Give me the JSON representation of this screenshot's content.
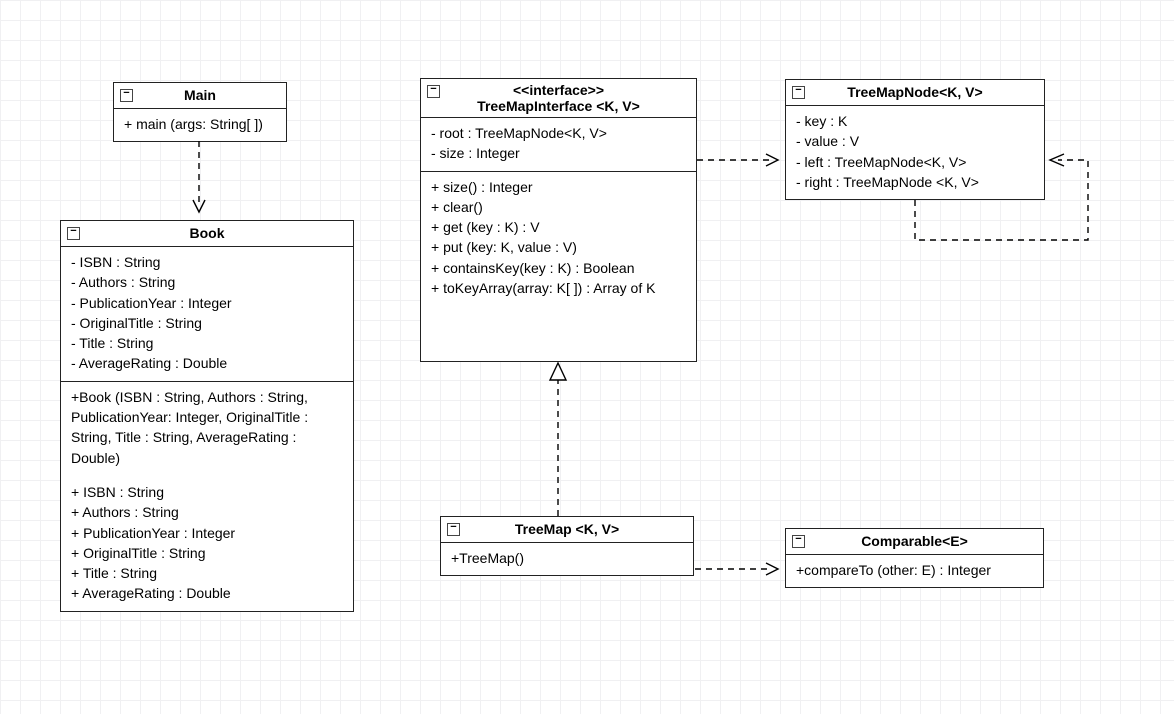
{
  "chart_data": {
    "type": "diagram",
    "title": "UML Class Diagram",
    "classes": [
      {
        "id": "Main",
        "name": "Main",
        "methods": [
          "+ main (args: String[ ])"
        ]
      },
      {
        "id": "Book",
        "name": "Book",
        "attrs": [
          "- ISBN : String",
          "- Authors : String",
          "- PublicationYear : Integer",
          "- OriginalTitle : String",
          "- Title : String",
          "- AverageRating : Double"
        ],
        "methods": [
          "+Book (ISBN : String, Authors : String, PublicationYear: Integer, OriginalTitle : String, Title : String, AverageRating : Double)",
          "",
          "+ ISBN : String",
          "+ Authors : String",
          "+ PublicationYear : Integer",
          "+ OriginalTitle : String",
          "+ Title : String",
          "+ AverageRating : Double"
        ]
      },
      {
        "id": "TreeMapInterface",
        "stereotype": "<<interface>>",
        "name": "TreeMapInterface <K, V>",
        "attrs": [
          "- root : TreeMapNode<K, V>",
          "- size : Integer"
        ],
        "methods": [
          "+ size() : Integer",
          "+ clear()",
          "+ get (key : K) : V",
          "+ put (key: K, value : V)",
          "+ containsKey(key : K) : Boolean",
          "+ toKeyArray(array: K[ ]) : Array of K"
        ]
      },
      {
        "id": "TreeMapNode",
        "name": "TreeMapNode<K, V>",
        "attrs": [
          "- key : K",
          "- value : V",
          "- left : TreeMapNode<K, V>",
          "- right : TreeMapNode <K, V>"
        ]
      },
      {
        "id": "TreeMap",
        "name": "TreeMap <K, V>",
        "methods": [
          "+TreeMap()"
        ]
      },
      {
        "id": "Comparable",
        "name": "Comparable<E>",
        "methods": [
          "+compareTo (other: E) : Integer"
        ]
      }
    ],
    "relations": [
      {
        "from": "Main",
        "to": "Book",
        "kind": "dependency"
      },
      {
        "from": "TreeMapInterface",
        "to": "TreeMapNode",
        "kind": "dependency"
      },
      {
        "from": "TreeMap",
        "to": "TreeMapInterface",
        "kind": "realization"
      },
      {
        "from": "TreeMap",
        "to": "Comparable",
        "kind": "dependency"
      },
      {
        "from": "TreeMapNode",
        "to": "TreeMapNode",
        "kind": "dependency_self"
      }
    ]
  },
  "main": {
    "title": "Main",
    "m0": "+ main (args: String[ ])"
  },
  "book": {
    "title": "Book",
    "a0": "- ISBN : String",
    "a1": "- Authors : String",
    "a2": "- PublicationYear : Integer",
    "a3": "- OriginalTitle : String",
    "a4": "- Title : String",
    "a5": "- AverageRating : Double",
    "m0": "+Book (ISBN : String, Authors : String,",
    "m1": "PublicationYear: Integer, OriginalTitle :",
    "m2": "String, Title : String, AverageRating :",
    "m3": "Double)",
    "m4": "+ ISBN : String",
    "m5": "+ Authors : String",
    "m6": "+ PublicationYear : Integer",
    "m7": "+ OriginalTitle : String",
    "m8": "+ Title : String",
    "m9": "+ AverageRating : Double"
  },
  "iface": {
    "stereo": "<<interface>>",
    "title": "TreeMapInterface <K, V>",
    "a0": "- root : TreeMapNode<K, V>",
    "a1": "- size : Integer",
    "m0": "+ size() : Integer",
    "m1": "+ clear()",
    "m2": "+ get (key : K) : V",
    "m3": "+ put (key: K, value : V)",
    "m4": "+ containsKey(key : K) : Boolean",
    "m5": "+ toKeyArray(array: K[ ]) : Array of K"
  },
  "node": {
    "title": "TreeMapNode<K, V>",
    "a0": "- key : K",
    "a1": "- value : V",
    "a2": "- left : TreeMapNode<K, V>",
    "a3": "- right : TreeMapNode <K, V>"
  },
  "treemap": {
    "title": "TreeMap <K, V>",
    "m0": "+TreeMap()"
  },
  "comp": {
    "title": "Comparable<E>",
    "m0": "+compareTo (other: E) : Integer"
  }
}
